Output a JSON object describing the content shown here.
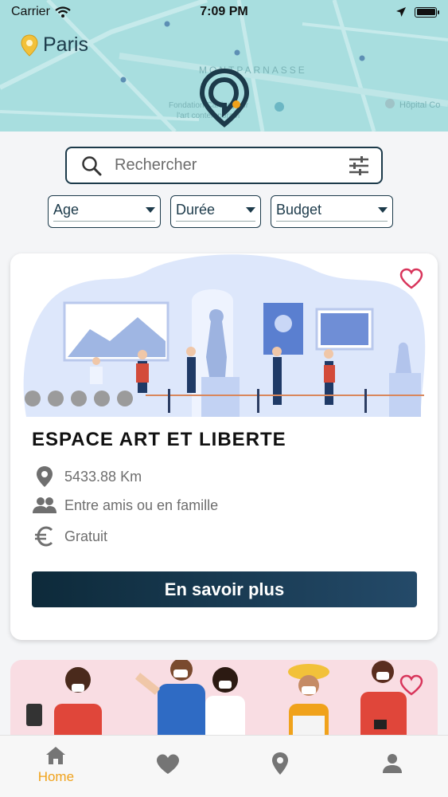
{
  "status_bar": {
    "carrier": "Carrier",
    "time": "7:09 PM"
  },
  "header": {
    "city": "Paris",
    "map_labels": [
      "MONTPARNASSE",
      "Fondation Cartier pour l'art contemporain",
      "Hôpital Co"
    ]
  },
  "search": {
    "placeholder": "Rechercher"
  },
  "filters": [
    {
      "label": "Age"
    },
    {
      "label": "Durée"
    },
    {
      "label": "Budget"
    }
  ],
  "card": {
    "title": "ESPACE ART ET LIBERTE",
    "distance": "5433.88 Km",
    "audience": "Entre amis ou en famille",
    "price": "Gratuit",
    "button": "En savoir plus",
    "slides_count": 5
  },
  "tabs": [
    {
      "label": "Home",
      "icon": "home-icon",
      "active": true
    },
    {
      "label": "",
      "icon": "heart-icon",
      "active": false
    },
    {
      "label": "",
      "icon": "location-pin-icon",
      "active": false
    },
    {
      "label": "",
      "icon": "person-icon",
      "active": false
    }
  ],
  "colors": {
    "primary": "#1c3a4a",
    "accent": "#f0a21b",
    "favorite": "#d8355b",
    "map": "#a9dfe0"
  }
}
